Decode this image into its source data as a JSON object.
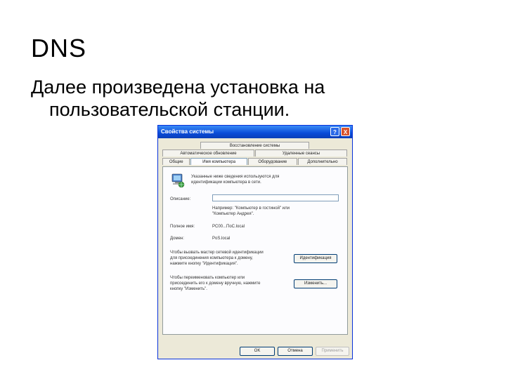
{
  "slide": {
    "title": "DNS",
    "text_line1": "Далее произведена установка на",
    "text_line2": "пользовательской станции."
  },
  "dialog": {
    "title": "Свойства системы",
    "help_label": "?",
    "close_label": "X",
    "tabs_row1": [
      "Восстановление системы"
    ],
    "tabs_row2": [
      "Автоматическое обновление",
      "Удаленные сеансы"
    ],
    "tabs_row3": [
      "Общие",
      "Имя компьютера",
      "Оборудование",
      "Дополнительно"
    ],
    "active_tab": "Имя компьютера",
    "description_line1": "Указанные ниже сведения используются для",
    "description_line2": "идентификации компьютера в сети.",
    "description_label": "Описание:",
    "description_value": "",
    "example_line1": "Например: \"Компьютер в гостиной\" или",
    "example_line2": "\"Компьютер Андрея\".",
    "fullname_label": "Полное имя:",
    "fullname_value": "PC00...ПоС.local",
    "domain_label": "Домен:",
    "domain_value": "PoS.local",
    "wizard_text_line1": "Чтобы вызвать мастер сетевой идентификации",
    "wizard_text_line2": "для присоединения компьютера к домену,",
    "wizard_text_line3": "нажмите кнопку \"Идентификация\".",
    "wizard_button": "Идентификация",
    "rename_text_line1": "Чтобы переименовать компьютер или",
    "rename_text_line2": "присоединить его к домену вручную, нажмите",
    "rename_text_line3": "кнопку \"Изменить\".",
    "rename_button": "Изменить...",
    "ok_button": "OK",
    "cancel_button": "Отмена",
    "apply_button": "Применить"
  }
}
